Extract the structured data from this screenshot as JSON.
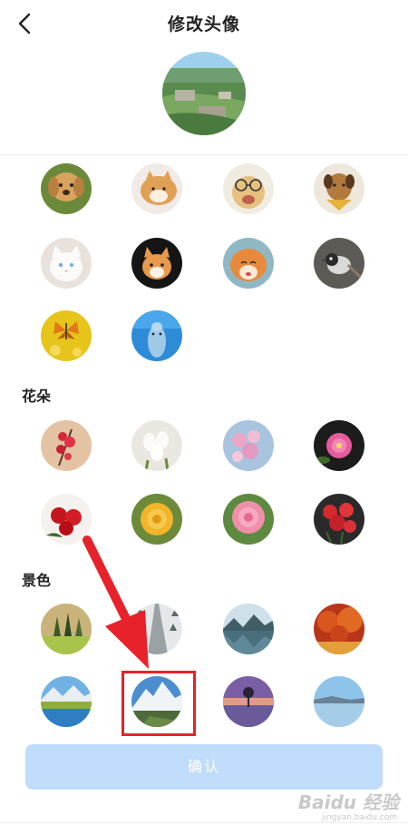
{
  "header": {
    "title": "修改头像",
    "back_icon": "chevron-left-icon"
  },
  "sections": {
    "flowers_title": "花朵",
    "scenery_title": "景色"
  },
  "confirm_label": "确认",
  "watermark": {
    "brand": "Baidu 经验",
    "url": "jingyan.baidu.com"
  },
  "colors": {
    "accent": "#e8222a",
    "confirm_bg": "#bfdcfa"
  }
}
